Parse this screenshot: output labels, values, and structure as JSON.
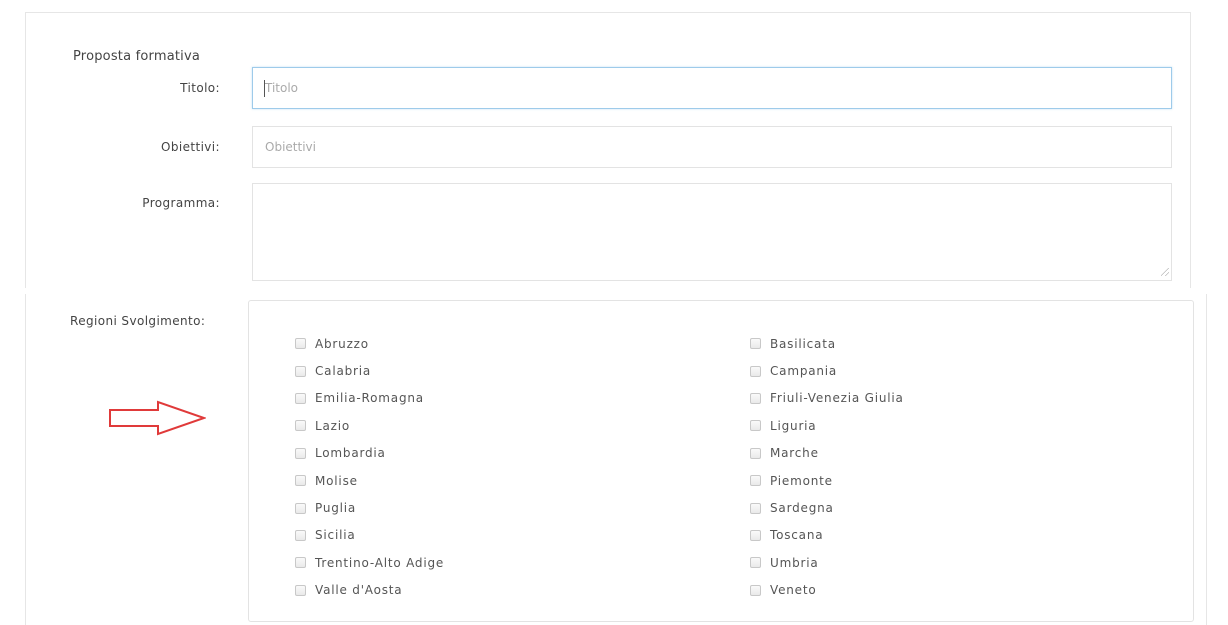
{
  "form": {
    "section_title": "Proposta formativa",
    "titolo": {
      "label": "Titolo:",
      "placeholder": "Titolo",
      "value": ""
    },
    "obiettivi": {
      "label": "Obiettivi:",
      "placeholder": "Obiettivi",
      "value": ""
    },
    "programma": {
      "label": "Programma:",
      "value": ""
    }
  },
  "regions": {
    "label": "Regioni Svolgimento:",
    "left_column": [
      {
        "name": "Abruzzo",
        "checked": false
      },
      {
        "name": "Calabria",
        "checked": false
      },
      {
        "name": "Emilia-Romagna",
        "checked": false
      },
      {
        "name": "Lazio",
        "checked": false
      },
      {
        "name": "Lombardia",
        "checked": false
      },
      {
        "name": "Molise",
        "checked": false
      },
      {
        "name": "Puglia",
        "checked": false
      },
      {
        "name": "Sicilia",
        "checked": false
      },
      {
        "name": "Trentino-Alto Adige",
        "checked": false
      },
      {
        "name": "Valle d'Aosta",
        "checked": false
      }
    ],
    "right_column": [
      {
        "name": "Basilicata",
        "checked": false
      },
      {
        "name": "Campania",
        "checked": false
      },
      {
        "name": "Friuli-Venezia Giulia",
        "checked": false
      },
      {
        "name": "Liguria",
        "checked": false
      },
      {
        "name": "Marche",
        "checked": false
      },
      {
        "name": "Piemonte",
        "checked": false
      },
      {
        "name": "Sardegna",
        "checked": false
      },
      {
        "name": "Toscana",
        "checked": false
      },
      {
        "name": "Umbria",
        "checked": false
      },
      {
        "name": "Veneto",
        "checked": false
      }
    ]
  },
  "annotation": {
    "arrow_icon": "right-arrow-outline-icon",
    "arrow_color": "#e03a3a"
  }
}
